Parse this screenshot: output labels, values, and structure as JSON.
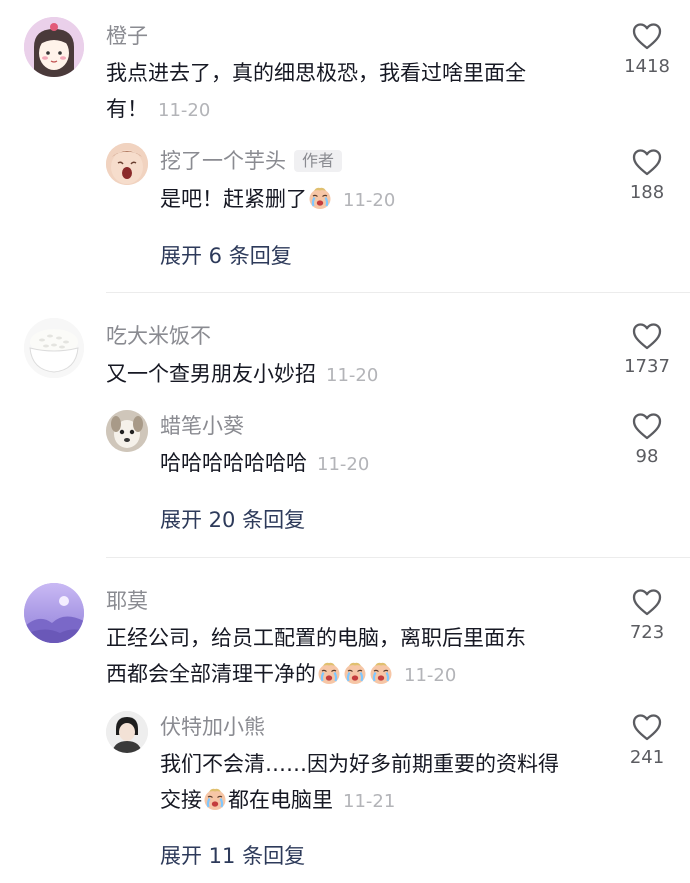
{
  "threads": [
    {
      "comment": {
        "username": "橙子",
        "text_line1": "我点进去了，真的细思极恐，我看过啥里面全",
        "text_line2": "有！",
        "time": "11-20",
        "likes": "1418"
      },
      "reply": {
        "username": "挖了一个芋头",
        "author_tag": "作者",
        "text": "是吧！赶紧删了",
        "time": "11-20",
        "likes": "188"
      },
      "expand_label": "展开 6 条回复"
    },
    {
      "comment": {
        "username": "吃大米饭不",
        "text": "又一个查男朋友小妙招",
        "time": "11-20",
        "likes": "1737"
      },
      "reply": {
        "username": "蜡笔小葵",
        "text": "哈哈哈哈哈哈哈",
        "time": "11-20",
        "likes": "98"
      },
      "expand_label": "展开 20 条回复"
    },
    {
      "comment": {
        "username": "耶莫",
        "text_line1": "正经公司，给员工配置的电脑，离职后里面东",
        "text_line2": "西都会全部清理干净的",
        "time": "11-20",
        "likes": "723"
      },
      "reply": {
        "username": "伏特加小熊",
        "text_line1": "我们不会清……因为好多前期重要的资料得",
        "text_line2_a": "交接",
        "text_line2_b": "都在电脑里",
        "time": "11-21",
        "likes": "241"
      },
      "expand_label": "展开 11 条回复"
    }
  ],
  "icons": {
    "like": "heart-outline-icon",
    "emoji": "crying-face-emoji"
  },
  "colors": {
    "username": "#8a8b91",
    "text": "#161823",
    "time": "#b3b4b8",
    "expand": "#2d3a5a"
  }
}
